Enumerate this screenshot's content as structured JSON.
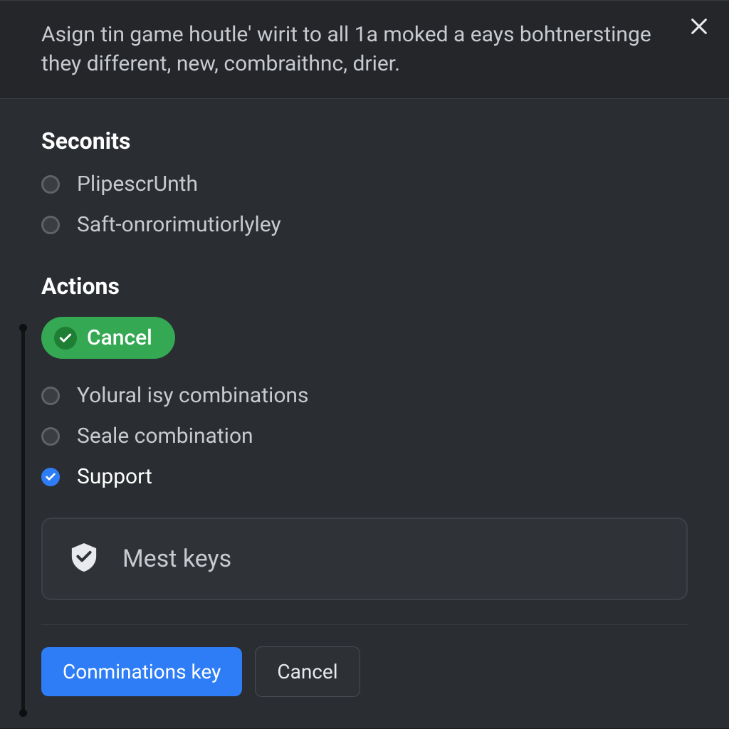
{
  "header": {
    "description": "Asign tin game houtle' wirit to all 1a moked a eays bohtnerstinge they different, new, combraithnc, drier."
  },
  "sections": {
    "seconits": {
      "title": "Seconits",
      "options": [
        {
          "label": "PlipescrUnth",
          "checked": false
        },
        {
          "label": "Saft-onrorimutiorlyley",
          "checked": false
        }
      ]
    },
    "actions": {
      "title": "Actions",
      "pill_label": "Cancel",
      "options": [
        {
          "label": "Yolural isy combinations",
          "checked": false
        },
        {
          "label": "Seale combination",
          "checked": false
        },
        {
          "label": "Support",
          "checked": true
        }
      ]
    }
  },
  "card": {
    "text": "Mest keys"
  },
  "footer": {
    "primary_label": "Conminations key",
    "secondary_label": "Cancel"
  },
  "icons": {
    "close": "close-icon",
    "check": "check-icon",
    "shield": "shield-check-icon"
  }
}
